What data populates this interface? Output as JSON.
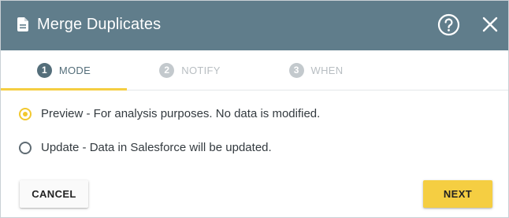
{
  "dialog": {
    "title": "Merge Duplicates",
    "title_icon": "document-icon",
    "help_icon": "help-circle-icon",
    "close_icon": "close-icon"
  },
  "tabs": [
    {
      "number": "1",
      "label": "MODE",
      "active": true
    },
    {
      "number": "2",
      "label": "NOTIFY",
      "active": false
    },
    {
      "number": "3",
      "label": "WHEN",
      "active": false
    }
  ],
  "options": [
    {
      "label": "Preview - For analysis purposes. No data is modified.",
      "selected": true
    },
    {
      "label": "Update -  Data in Salesforce will be updated.",
      "selected": false
    }
  ],
  "buttons": {
    "cancel": "CANCEL",
    "next": "NEXT"
  },
  "colors": {
    "header": "#607d8b",
    "accent": "#f5ce42",
    "active_step": "#546e7a",
    "inactive_step": "#c3c9cd"
  }
}
